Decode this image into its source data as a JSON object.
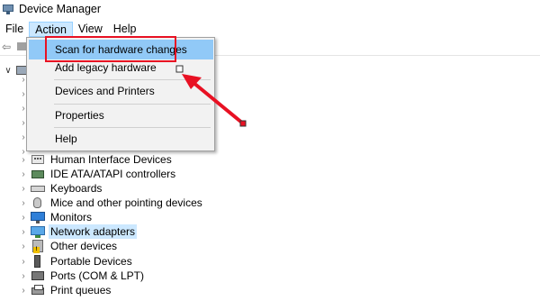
{
  "window": {
    "title": "Device Manager"
  },
  "menubar": {
    "items": [
      "File",
      "Action",
      "View",
      "Help"
    ],
    "active": "Action"
  },
  "action_menu": {
    "items": [
      {
        "label": "Scan for hardware changes",
        "highlighted": true
      },
      {
        "label": "Add legacy hardware"
      },
      {
        "label": "Devices and Printers"
      },
      {
        "label": "Properties"
      },
      {
        "label": "Help"
      }
    ]
  },
  "tree": {
    "devices": [
      {
        "label": "Human Interface Devices",
        "icon": "hid-icon"
      },
      {
        "label": "IDE ATA/ATAPI controllers",
        "icon": "ide-controller-icon"
      },
      {
        "label": "Keyboards",
        "icon": "keyboard-icon"
      },
      {
        "label": "Mice and other pointing devices",
        "icon": "mouse-icon"
      },
      {
        "label": "Monitors",
        "icon": "monitor-icon"
      },
      {
        "label": "Network adapters",
        "icon": "network-adapter-icon",
        "selected": true
      },
      {
        "label": "Other devices",
        "icon": "other-device-icon"
      },
      {
        "label": "Portable Devices",
        "icon": "portable-device-icon"
      },
      {
        "label": "Ports (COM & LPT)",
        "icon": "ports-icon"
      },
      {
        "label": "Print queues",
        "icon": "printer-icon"
      }
    ]
  },
  "colors": {
    "highlight_border": "#e81123",
    "menu_hover": "#91c9f7",
    "tree_selected": "#cce8ff"
  }
}
